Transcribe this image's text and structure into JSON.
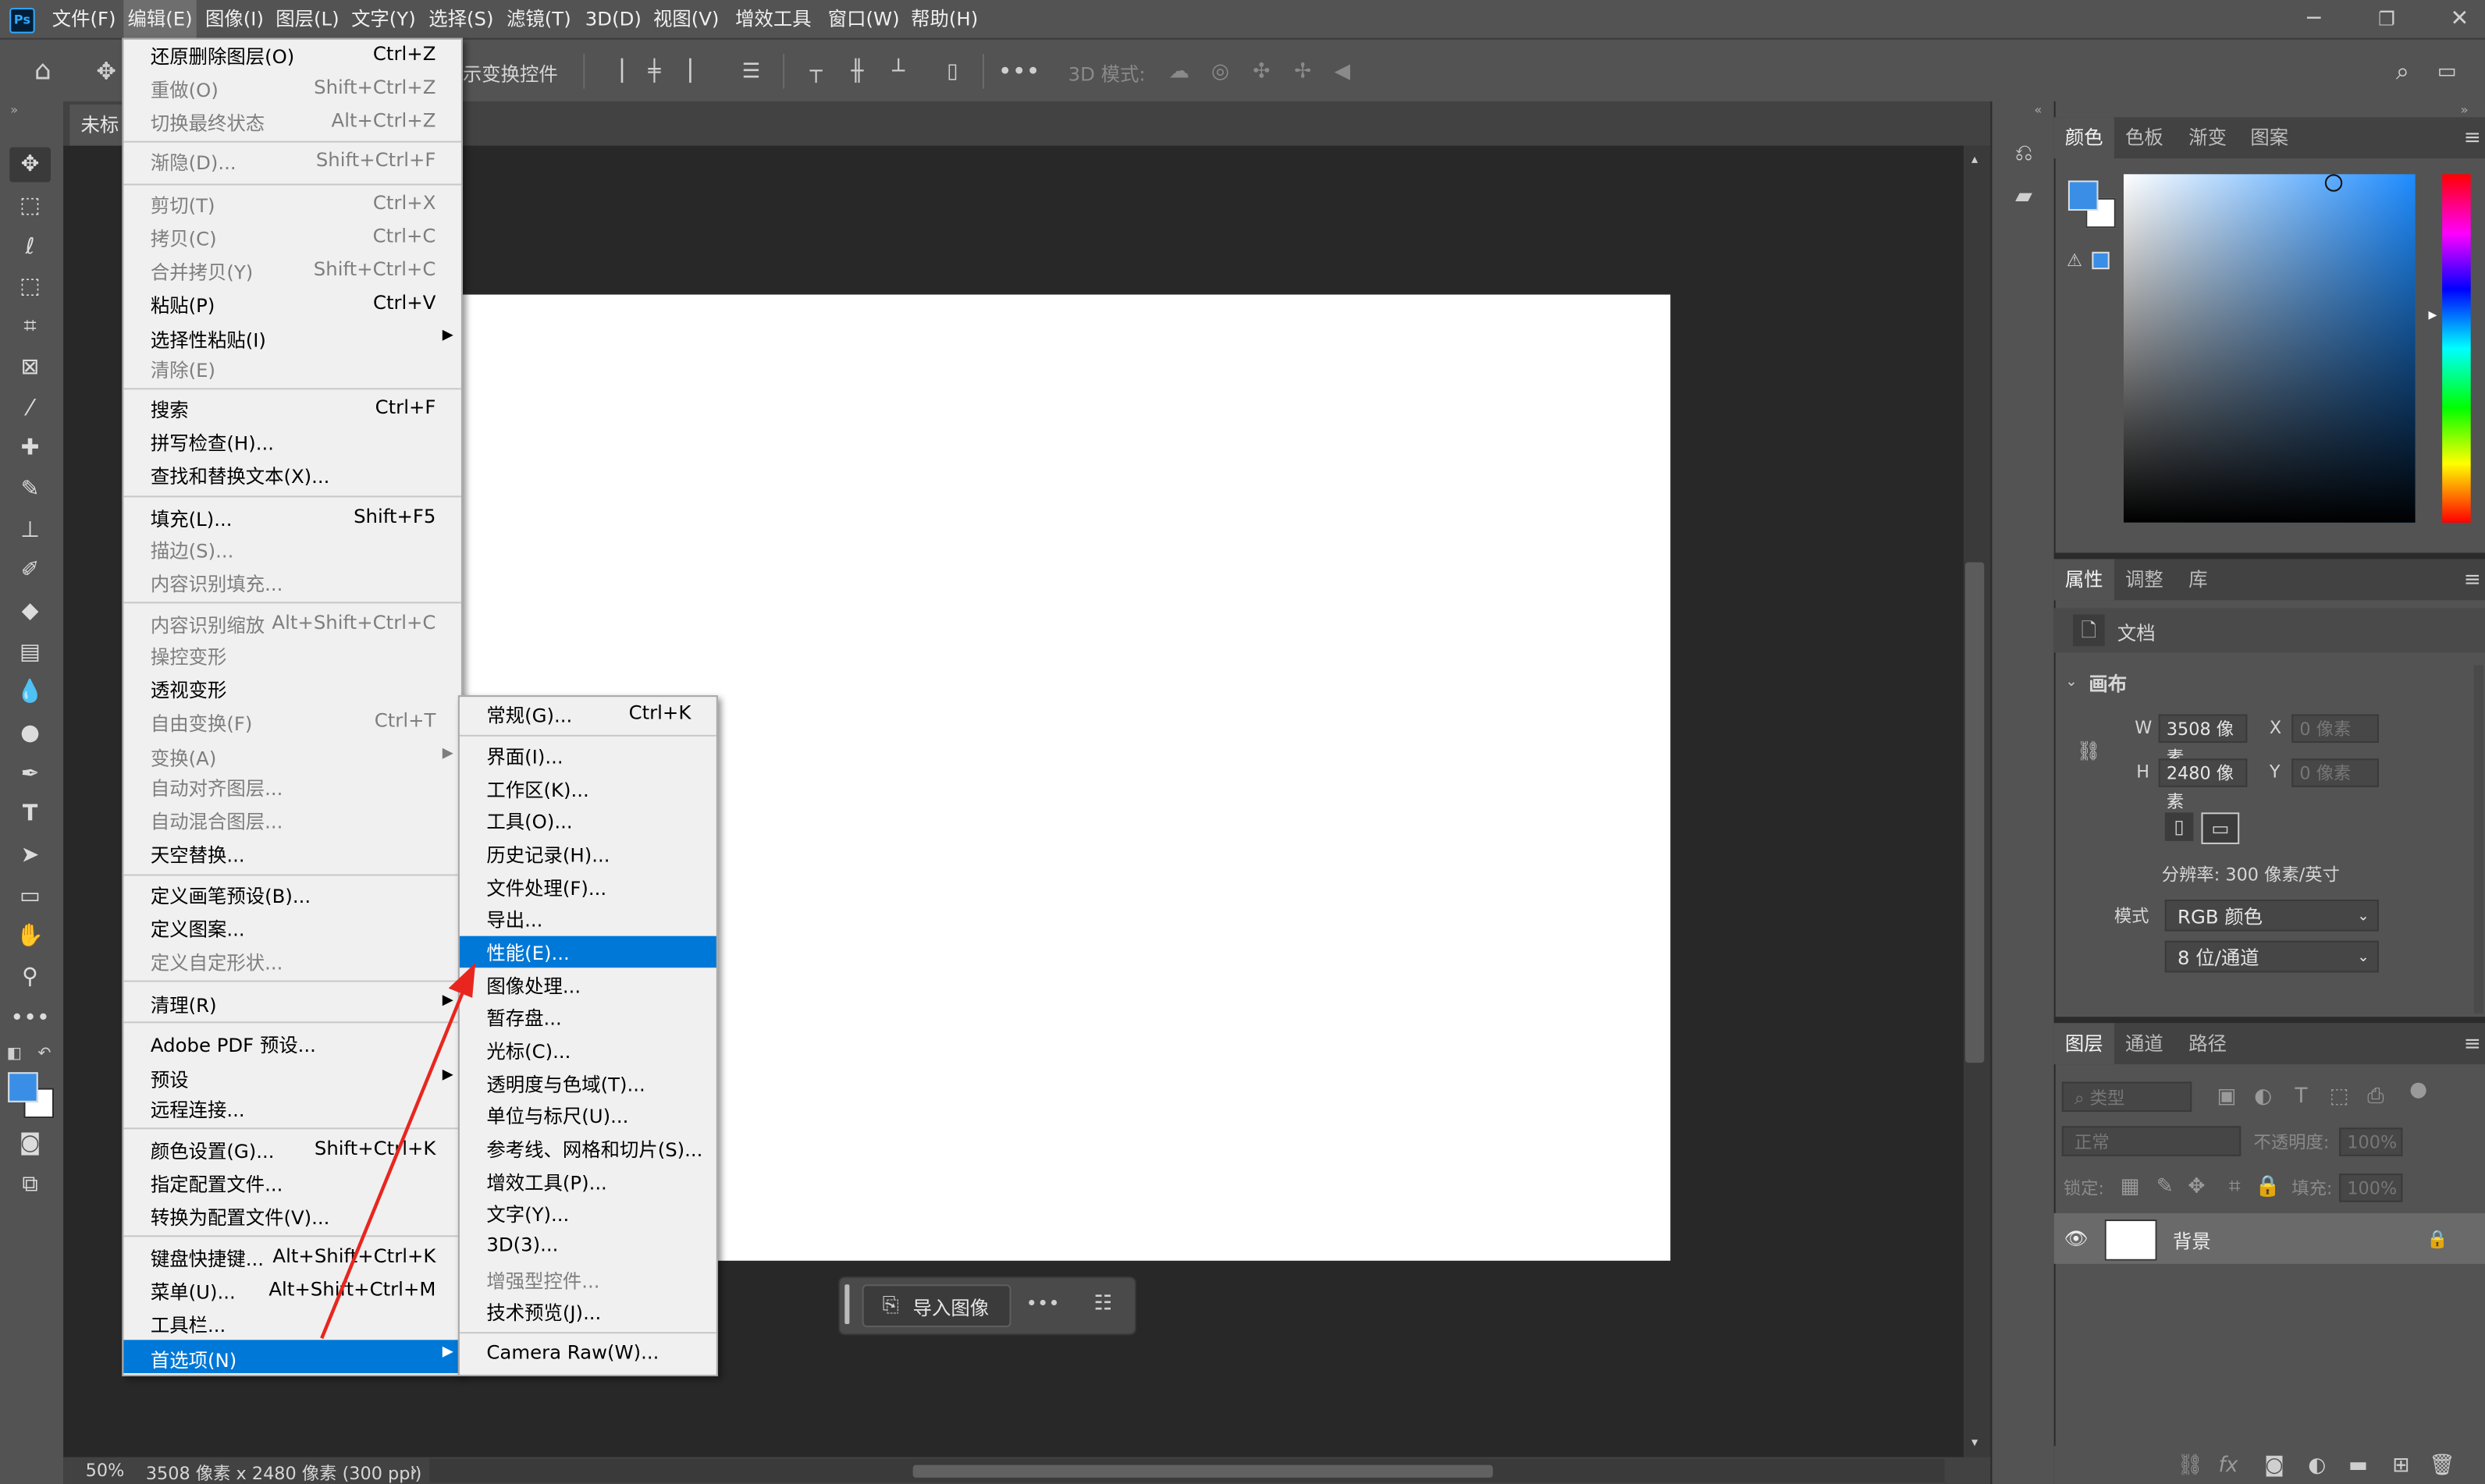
{
  "menubar": {
    "logo": "Ps",
    "items": [
      "文件(F)",
      "编辑(E)",
      "图像(I)",
      "图层(L)",
      "文字(Y)",
      "选择(S)",
      "滤镜(T)",
      "3D(D)",
      "视图(V)",
      "增效工具",
      "窗口(W)",
      "帮助(H)"
    ]
  },
  "options_bar": {
    "transform_controls_partial": "示变换控件",
    "mode_3d": "3D 模式:"
  },
  "document": {
    "tab_title_partial": "未标"
  },
  "status": {
    "zoom": "50%",
    "info": "3508 像素 x 2480 像素 (300 ppi)"
  },
  "taskbar": {
    "import_label": "导入图像"
  },
  "edit_menu": {
    "items": [
      {
        "label": "还原删除图层(O)",
        "shortcut": "Ctrl+Z",
        "disabled": false
      },
      {
        "label": "重做(O)",
        "shortcut": "Shift+Ctrl+Z",
        "disabled": true
      },
      {
        "label": "切换最终状态",
        "shortcut": "Alt+Ctrl+Z",
        "disabled": true
      },
      {
        "label": "渐隐(D)...",
        "shortcut": "Shift+Ctrl+F",
        "disabled": true
      },
      {
        "label": "剪切(T)",
        "shortcut": "Ctrl+X",
        "disabled": true
      },
      {
        "label": "拷贝(C)",
        "shortcut": "Ctrl+C",
        "disabled": true
      },
      {
        "label": "合并拷贝(Y)",
        "shortcut": "Shift+Ctrl+C",
        "disabled": true
      },
      {
        "label": "粘贴(P)",
        "shortcut": "Ctrl+V",
        "disabled": false
      },
      {
        "label": "选择性粘贴(I)",
        "shortcut": "",
        "disabled": false,
        "submenu": true
      },
      {
        "label": "清除(E)",
        "shortcut": "",
        "disabled": true
      },
      {
        "label": "搜索",
        "shortcut": "Ctrl+F",
        "disabled": false
      },
      {
        "label": "拼写检查(H)...",
        "shortcut": "",
        "disabled": false
      },
      {
        "label": "查找和替换文本(X)...",
        "shortcut": "",
        "disabled": false
      },
      {
        "label": "填充(L)...",
        "shortcut": "Shift+F5",
        "disabled": false
      },
      {
        "label": "描边(S)...",
        "shortcut": "",
        "disabled": true
      },
      {
        "label": "内容识别填充...",
        "shortcut": "",
        "disabled": true
      },
      {
        "label": "内容识别缩放",
        "shortcut": "Alt+Shift+Ctrl+C",
        "disabled": true
      },
      {
        "label": "操控变形",
        "shortcut": "",
        "disabled": true
      },
      {
        "label": "透视变形",
        "shortcut": "",
        "disabled": false
      },
      {
        "label": "自由变换(F)",
        "shortcut": "Ctrl+T",
        "disabled": true
      },
      {
        "label": "变换(A)",
        "shortcut": "",
        "disabled": true,
        "submenu": true
      },
      {
        "label": "自动对齐图层...",
        "shortcut": "",
        "disabled": true
      },
      {
        "label": "自动混合图层...",
        "shortcut": "",
        "disabled": true
      },
      {
        "label": "天空替换...",
        "shortcut": "",
        "disabled": false
      },
      {
        "label": "定义画笔预设(B)...",
        "shortcut": "",
        "disabled": false
      },
      {
        "label": "定义图案...",
        "shortcut": "",
        "disabled": false
      },
      {
        "label": "定义自定形状...",
        "shortcut": "",
        "disabled": true
      },
      {
        "label": "清理(R)",
        "shortcut": "",
        "disabled": false,
        "submenu": true
      },
      {
        "label": "Adobe PDF 预设...",
        "shortcut": "",
        "disabled": false
      },
      {
        "label": "预设",
        "shortcut": "",
        "disabled": false,
        "submenu": true
      },
      {
        "label": "远程连接...",
        "shortcut": "",
        "disabled": false
      },
      {
        "label": "颜色设置(G)...",
        "shortcut": "Shift+Ctrl+K",
        "disabled": false
      },
      {
        "label": "指定配置文件...",
        "shortcut": "",
        "disabled": false
      },
      {
        "label": "转换为配置文件(V)...",
        "shortcut": "",
        "disabled": false
      },
      {
        "label": "键盘快捷键...",
        "shortcut": "Alt+Shift+Ctrl+K",
        "disabled": false
      },
      {
        "label": "菜单(U)...",
        "shortcut": "Alt+Shift+Ctrl+M",
        "disabled": false
      },
      {
        "label": "工具栏...",
        "shortcut": "",
        "disabled": false
      },
      {
        "label": "首选项(N)",
        "shortcut": "",
        "disabled": false,
        "submenu": true,
        "highlighted": true
      }
    ]
  },
  "preferences_submenu": {
    "items": [
      {
        "label": "常规(G)...",
        "shortcut": "Ctrl+K",
        "disabled": false
      },
      {
        "label": "界面(I)...",
        "disabled": false
      },
      {
        "label": "工作区(K)...",
        "disabled": false
      },
      {
        "label": "工具(O)...",
        "disabled": false
      },
      {
        "label": "历史记录(H)...",
        "disabled": false
      },
      {
        "label": "文件处理(F)...",
        "disabled": false
      },
      {
        "label": "导出...",
        "disabled": false
      },
      {
        "label": "性能(E)...",
        "disabled": false,
        "highlighted": true
      },
      {
        "label": "图像处理...",
        "disabled": false
      },
      {
        "label": "暂存盘...",
        "disabled": false
      },
      {
        "label": "光标(C)...",
        "disabled": false
      },
      {
        "label": "透明度与色域(T)...",
        "disabled": false
      },
      {
        "label": "单位与标尺(U)...",
        "disabled": false
      },
      {
        "label": "参考线、网格和切片(S)...",
        "disabled": false
      },
      {
        "label": "增效工具(P)...",
        "disabled": false
      },
      {
        "label": "文字(Y)...",
        "disabled": false
      },
      {
        "label": "3D(3)...",
        "disabled": false
      },
      {
        "label": "增强型控件...",
        "disabled": true
      },
      {
        "label": "技术预览(J)...",
        "disabled": false
      },
      {
        "label": "Camera Raw(W)...",
        "disabled": false
      }
    ]
  },
  "color_panel": {
    "tabs": [
      "颜色",
      "色板",
      "渐变",
      "图案"
    ],
    "foreground": "#3a8ee6",
    "background": "#ffffff"
  },
  "properties_panel": {
    "tabs": [
      "属性",
      "调整",
      "库"
    ],
    "doc_label": "文档",
    "section": "画布",
    "w_label": "W",
    "w_value": "3508 像素",
    "h_label": "H",
    "h_value": "2480 像素",
    "x_label": "X",
    "x_placeholder": "0 像素",
    "y_label": "Y",
    "y_placeholder": "0 像素",
    "resolution": "分辨率: 300 像素/英寸",
    "mode_label": "模式",
    "mode_value": "RGB 颜色",
    "depth_value": "8 位/通道"
  },
  "layers_panel": {
    "tabs": [
      "图层",
      "通道",
      "路径"
    ],
    "filter_placeholder": "类型",
    "blend_mode": "正常",
    "opacity_label": "不透明度:",
    "opacity_value": "100%",
    "lock_label": "锁定:",
    "fill_label": "填充:",
    "fill_value": "100%",
    "layer_name": "背景"
  },
  "annotation": {
    "arrow_color": "#e8261f"
  }
}
